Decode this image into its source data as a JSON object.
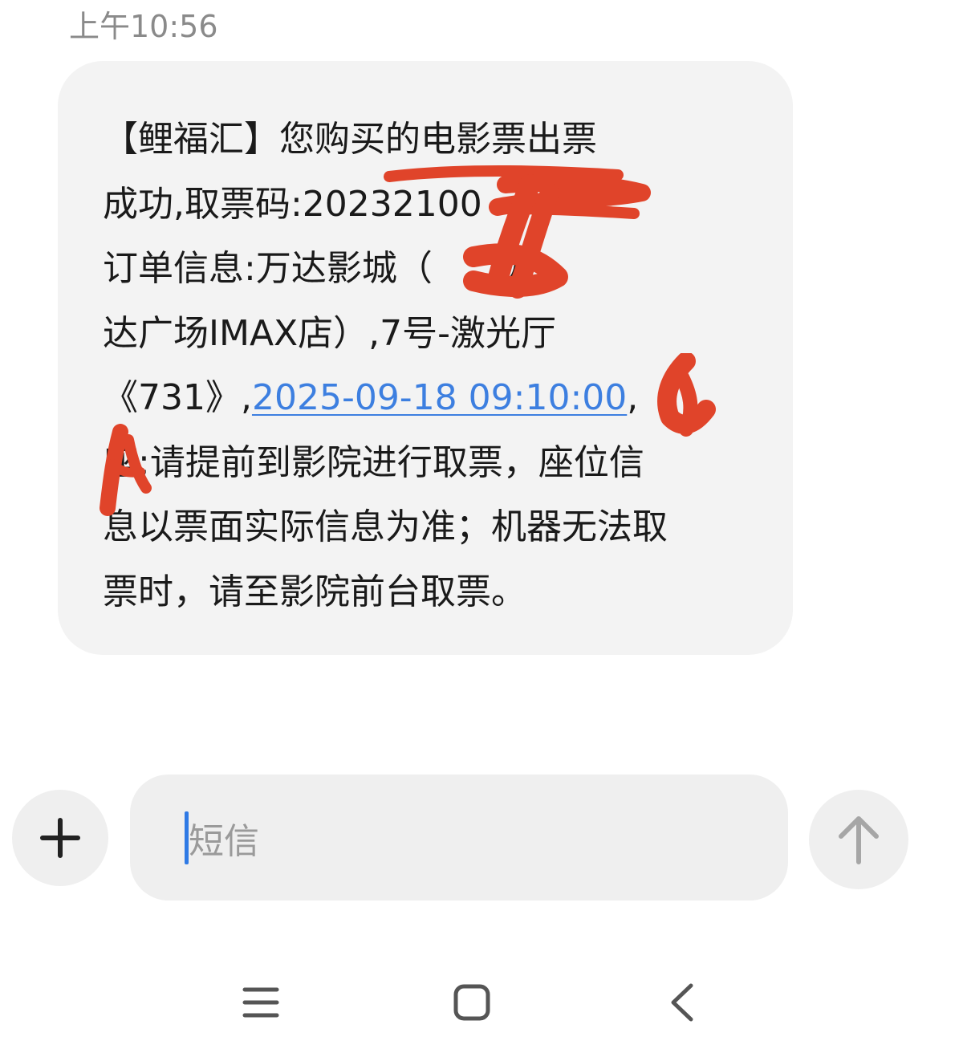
{
  "conversation": {
    "timestamp": "上午10:56",
    "message": {
      "lines": [
        "【鲤福汇】您购买的电影票出票",
        "成功,取票码:20232100",
        "订单信息:万达影城（　　万",
        "达广场IMAX店）,7号-激光厅",
        "座;请提前到影院进行取票，座位信",
        "息以票面实际信息为准；机器无法取",
        "票时，请至影院前台取票。"
      ],
      "line5_prefix": "《731》,",
      "line5_link": "2025-09-18 09:10:00",
      "line5_suffix": ",",
      "redaction_color": "#e0442a"
    }
  },
  "composer": {
    "placeholder": "短信",
    "add_icon": "plus-icon",
    "send_icon": "arrow-up-icon"
  },
  "navbar": {
    "menu_icon": "menu-icon",
    "home_icon": "square-home-icon",
    "back_icon": "chevron-left-icon"
  }
}
